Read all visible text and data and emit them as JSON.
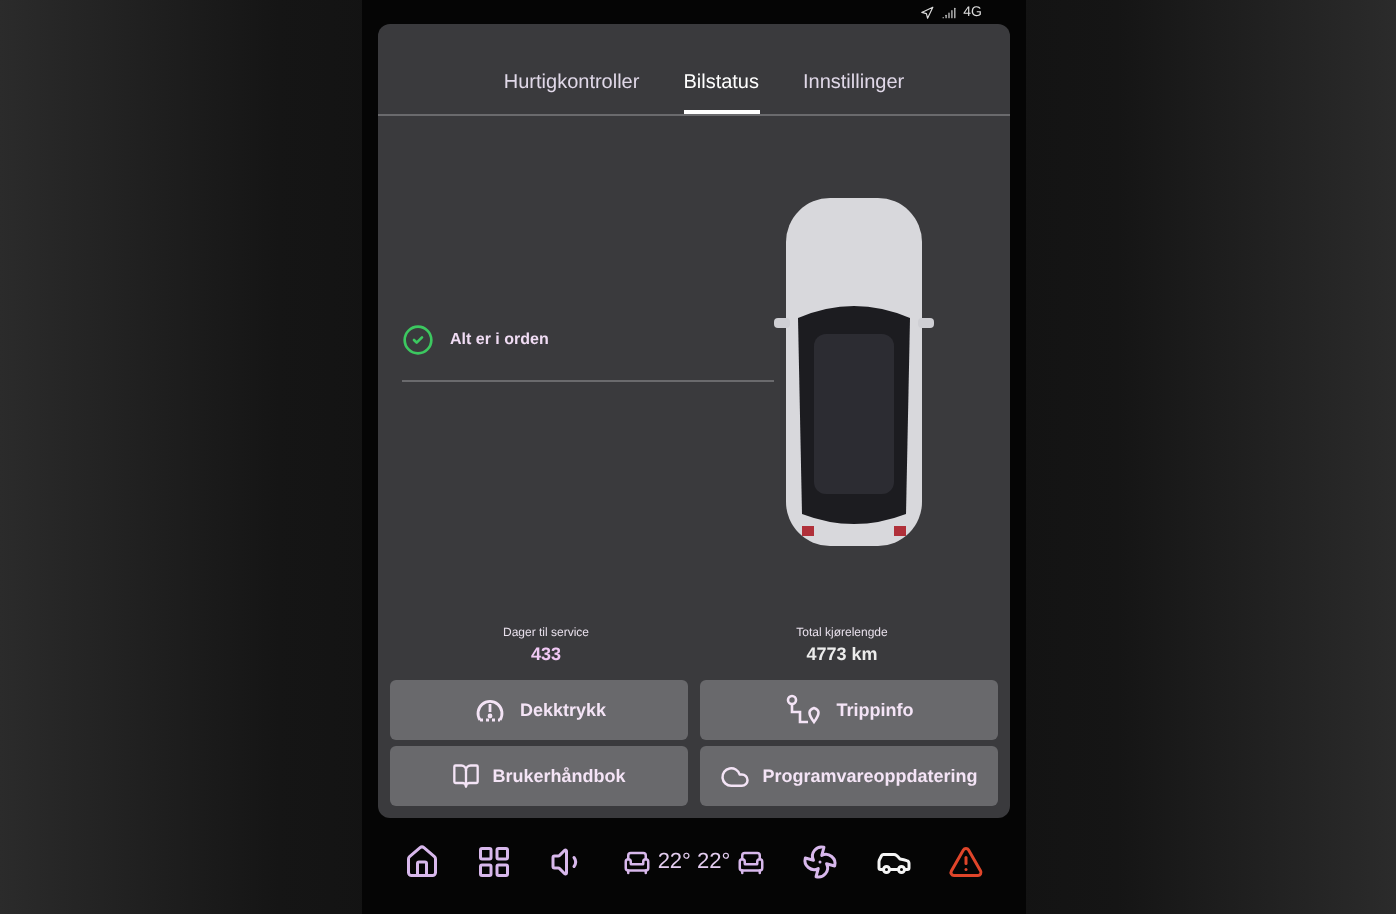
{
  "status_bar": {
    "network": "4G"
  },
  "tabs": [
    {
      "label": "Hurtigkontroller",
      "selected": false
    },
    {
      "label": "Bilstatus",
      "selected": true
    },
    {
      "label": "Innstillinger",
      "selected": false
    }
  ],
  "status": {
    "text": "Alt er i orden",
    "ok": true
  },
  "stats": [
    {
      "label": "Dager til service",
      "value": "433"
    },
    {
      "label": "Total kjørelengde",
      "value": "4773 km"
    }
  ],
  "buttons": [
    {
      "label": "Dekktrykk"
    },
    {
      "label": "Trippinfo"
    },
    {
      "label": "Brukerhåndbok"
    },
    {
      "label": "Programvareoppdatering"
    }
  ],
  "climate": {
    "driver_temp": "22°",
    "passenger_temp": "22°"
  }
}
